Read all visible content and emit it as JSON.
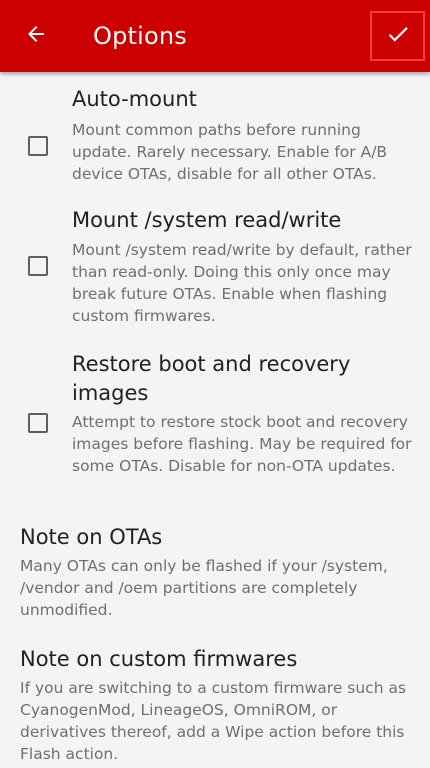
{
  "app_bar": {
    "title": "Options",
    "back_icon": "arrow-back-icon",
    "confirm_icon": "checkmark-icon",
    "background_color": "#cc0000",
    "highlight_color": "#ff3b3b"
  },
  "options": [
    {
      "title": "Auto-mount",
      "description": "Mount common paths before running update. Rarely necessary. Enable for A/B device OTAs, disable for all other OTAs.",
      "checked": false
    },
    {
      "title": "Mount /system read/write",
      "description": "Mount /system read/write by default, rather than read-only. Doing this only once may break future OTAs. Enable when flashing custom firmwares.",
      "checked": false
    },
    {
      "title": "Restore boot and recovery images",
      "description": "Attempt to restore stock boot and recovery images before flashing. May be required for some OTAs. Disable for non-OTA updates.",
      "checked": false
    }
  ],
  "notes": [
    {
      "title": "Note on OTAs",
      "text": "Many OTAs can only be flashed if your /system, /vendor and /oem partitions are completely unmodified."
    },
    {
      "title": "Note on custom firmwares",
      "text": "If you are switching to a custom firmware such as CyanogenMod, LineageOS, OmniROM, or derivatives thereof, add a Wipe action before this Flash action."
    }
  ]
}
